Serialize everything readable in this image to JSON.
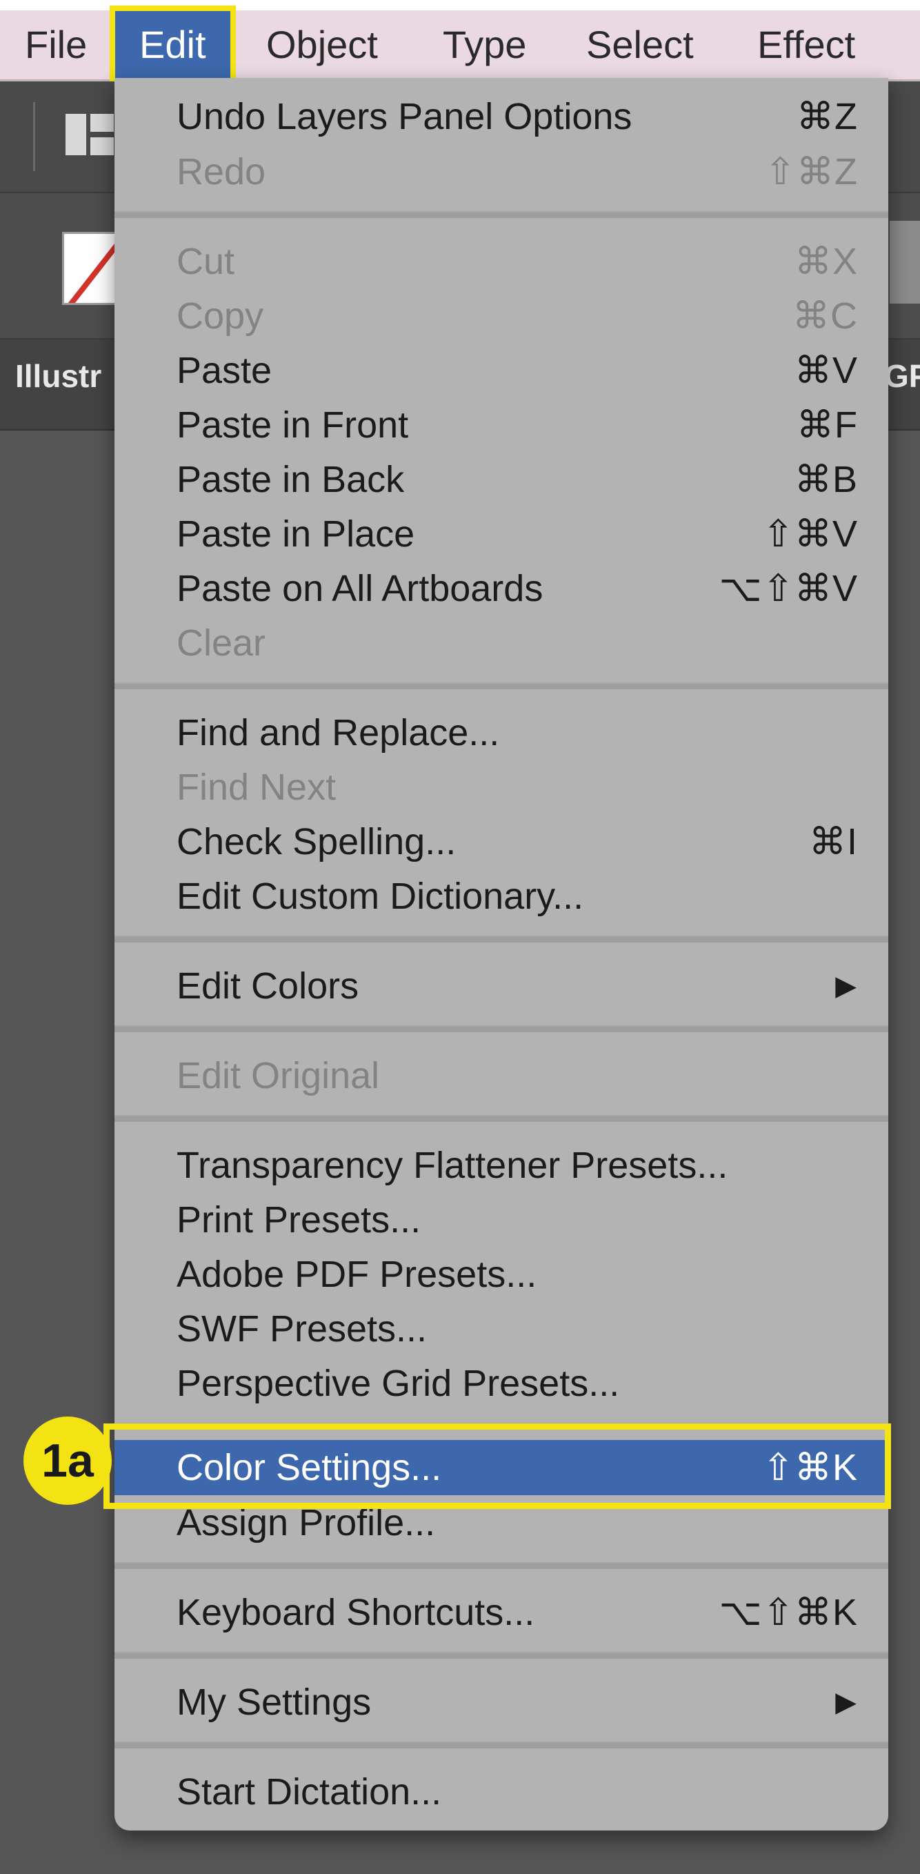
{
  "menubar": {
    "items": [
      {
        "label": "File"
      },
      {
        "label": "Edit"
      },
      {
        "label": "Object"
      },
      {
        "label": "Type"
      },
      {
        "label": "Select"
      },
      {
        "label": "Effect"
      }
    ],
    "active": "Edit"
  },
  "toolbar": {
    "document_tab_label": "Illustr",
    "document_tab_right": "GP"
  },
  "edit_menu": {
    "items": [
      {
        "label": "Undo Layers Panel Options",
        "shortcut": "⌘Z",
        "enabled": true
      },
      {
        "label": "Redo",
        "shortcut": "⇧⌘Z",
        "enabled": false
      },
      {
        "label": "Cut",
        "shortcut": "⌘X",
        "enabled": false
      },
      {
        "label": "Copy",
        "shortcut": "⌘C",
        "enabled": false
      },
      {
        "label": "Paste",
        "shortcut": "⌘V",
        "enabled": true
      },
      {
        "label": "Paste in Front",
        "shortcut": "⌘F",
        "enabled": true
      },
      {
        "label": "Paste in Back",
        "shortcut": "⌘B",
        "enabled": true
      },
      {
        "label": "Paste in Place",
        "shortcut": "⇧⌘V",
        "enabled": true
      },
      {
        "label": "Paste on All Artboards",
        "shortcut": "⌥⇧⌘V",
        "enabled": true
      },
      {
        "label": "Clear",
        "shortcut": "",
        "enabled": false
      },
      {
        "label": "Find and Replace...",
        "shortcut": "",
        "enabled": true
      },
      {
        "label": "Find Next",
        "shortcut": "",
        "enabled": false
      },
      {
        "label": "Check Spelling...",
        "shortcut": "⌘I",
        "enabled": true
      },
      {
        "label": "Edit Custom Dictionary...",
        "shortcut": "",
        "enabled": true
      },
      {
        "label": "Edit Colors",
        "submenu_icon": "▶",
        "enabled": true
      },
      {
        "label": "Edit Original",
        "shortcut": "",
        "enabled": false
      },
      {
        "label": "Transparency Flattener Presets...",
        "shortcut": "",
        "enabled": true
      },
      {
        "label": "Print Presets...",
        "shortcut": "",
        "enabled": true
      },
      {
        "label": "Adobe PDF Presets...",
        "shortcut": "",
        "enabled": true
      },
      {
        "label": "SWF Presets...",
        "shortcut": "",
        "enabled": true
      },
      {
        "label": "Perspective Grid Presets...",
        "shortcut": "",
        "enabled": true
      },
      {
        "label": "Color Settings...",
        "shortcut": "⇧⌘K",
        "enabled": true,
        "selected": true
      },
      {
        "label": "Assign Profile...",
        "shortcut": "",
        "enabled": true
      },
      {
        "label": "Keyboard Shortcuts...",
        "shortcut": "⌥⇧⌘K",
        "enabled": true
      },
      {
        "label": "My Settings",
        "submenu_icon": "▶",
        "enabled": true
      },
      {
        "label": "Start Dictation...",
        "shortcut": "",
        "enabled": true
      }
    ]
  },
  "annotation": {
    "step_badge": "1a",
    "highlight_color": "#f4e312",
    "selection_color": "#3d68ad"
  }
}
